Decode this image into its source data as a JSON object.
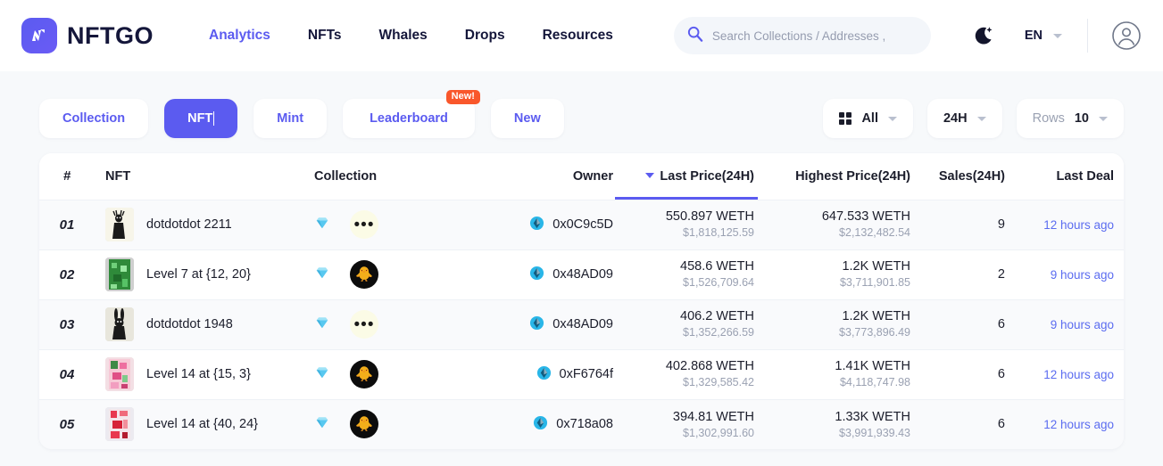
{
  "header": {
    "brand_name": "NFTGO",
    "logo_icon": "nftgo-logo-icon",
    "nav": [
      {
        "label": "Analytics",
        "active": true
      },
      {
        "label": "NFTs",
        "active": false
      },
      {
        "label": "Whales",
        "active": false
      },
      {
        "label": "Drops",
        "active": false
      },
      {
        "label": "Resources",
        "active": false
      }
    ],
    "search": {
      "placeholder": "Search Collections / Addresses ,",
      "value": "",
      "icon": "search-icon"
    },
    "theme_toggle_icon": "moon-icon",
    "language": "EN",
    "account_icon": "user-circle-icon"
  },
  "tabs": [
    {
      "label": "Collection",
      "active": false,
      "badge": ""
    },
    {
      "label": "NFT",
      "active": true,
      "badge": ""
    },
    {
      "label": "Mint",
      "active": false,
      "badge": ""
    },
    {
      "label": "Leaderboard",
      "active": false,
      "badge": "New!"
    },
    {
      "label": "New",
      "active": false,
      "badge": ""
    }
  ],
  "controls": {
    "category": {
      "label": "All",
      "icon": "grid-icon"
    },
    "timeframe": {
      "label": "24H"
    },
    "rows": {
      "prefix": "Rows",
      "value": "10"
    }
  },
  "table": {
    "columns": [
      {
        "key": "rank",
        "label": "#",
        "sorted": false
      },
      {
        "key": "nft",
        "label": "NFT",
        "sorted": false
      },
      {
        "key": "coll",
        "label": "Collection",
        "sorted": false
      },
      {
        "key": "owner",
        "label": "Owner",
        "sorted": false
      },
      {
        "key": "last",
        "label": "Last Price(24H)",
        "sorted": true
      },
      {
        "key": "high",
        "label": "Highest Price(24H)",
        "sorted": false
      },
      {
        "key": "sales",
        "label": "Sales(24H)",
        "sorted": false
      },
      {
        "key": "deal",
        "label": "Last Deal",
        "sorted": false
      }
    ],
    "sort_column": "Last Price(24H)",
    "sort_direction": "desc",
    "rows": [
      {
        "rank": "01",
        "nft_name": "dotdotdot 2211",
        "thumb": "deer-figure-thumbnail",
        "rarity_icon": "diamond-icon",
        "collection_avatar": "dotdotdot-avatar",
        "owner_icon": "ethereum-cube-icon",
        "owner": "0x0C9c5D",
        "last_price": "550.897 WETH",
        "last_price_usd": "$1,818,125.59",
        "highest_price": "647.533 WETH",
        "highest_price_usd": "$2,132,482.54",
        "sales": "9",
        "last_deal": "12 hours ago"
      },
      {
        "rank": "02",
        "nft_name": "Level 7 at {12, 20}",
        "thumb": "green-pixel-land-thumbnail",
        "rarity_icon": "diamond-icon",
        "collection_avatar": "otherdeed-avatar",
        "owner_icon": "ethereum-cube-icon",
        "owner": "0x48AD09",
        "last_price": "458.6 WETH",
        "last_price_usd": "$1,526,709.64",
        "highest_price": "1.2K WETH",
        "highest_price_usd": "$3,711,901.85",
        "sales": "2",
        "last_deal": "9 hours ago"
      },
      {
        "rank": "03",
        "nft_name": "dotdotdot 1948",
        "thumb": "rabbit-figure-thumbnail",
        "rarity_icon": "diamond-icon",
        "collection_avatar": "dotdotdot-avatar",
        "owner_icon": "ethereum-cube-icon",
        "owner": "0x48AD09",
        "last_price": "406.2 WETH",
        "last_price_usd": "$1,352,266.59",
        "highest_price": "1.2K WETH",
        "highest_price_usd": "$3,773,896.49",
        "sales": "6",
        "last_deal": "9 hours ago"
      },
      {
        "rank": "04",
        "nft_name": "Level 14 at {15, 3}",
        "thumb": "pink-pixel-land-thumbnail",
        "rarity_icon": "diamond-icon",
        "collection_avatar": "otherdeed-avatar",
        "owner_icon": "ethereum-cube-icon",
        "owner": "0xF6764f",
        "last_price": "402.868 WETH",
        "last_price_usd": "$1,329,585.42",
        "highest_price": "1.41K WETH",
        "highest_price_usd": "$4,118,747.98",
        "sales": "6",
        "last_deal": "12 hours ago"
      },
      {
        "rank": "05",
        "nft_name": "Level 14 at {40, 24}",
        "thumb": "red-pixel-land-thumbnail",
        "rarity_icon": "diamond-icon",
        "collection_avatar": "otherdeed-avatar",
        "owner_icon": "ethereum-cube-icon",
        "owner": "0x718a08",
        "last_price": "394.81 WETH",
        "last_price_usd": "$1,302,991.60",
        "highest_price": "1.33K WETH",
        "highest_price_usd": "$3,991,939.43",
        "sales": "6",
        "last_deal": "12 hours ago"
      }
    ]
  },
  "colors": {
    "accent": "#5b5bf0",
    "badge": "#f9572b",
    "link": "#5b6cf0",
    "page_bg": "#f7f9fb",
    "muted": "#9aa1b2"
  }
}
